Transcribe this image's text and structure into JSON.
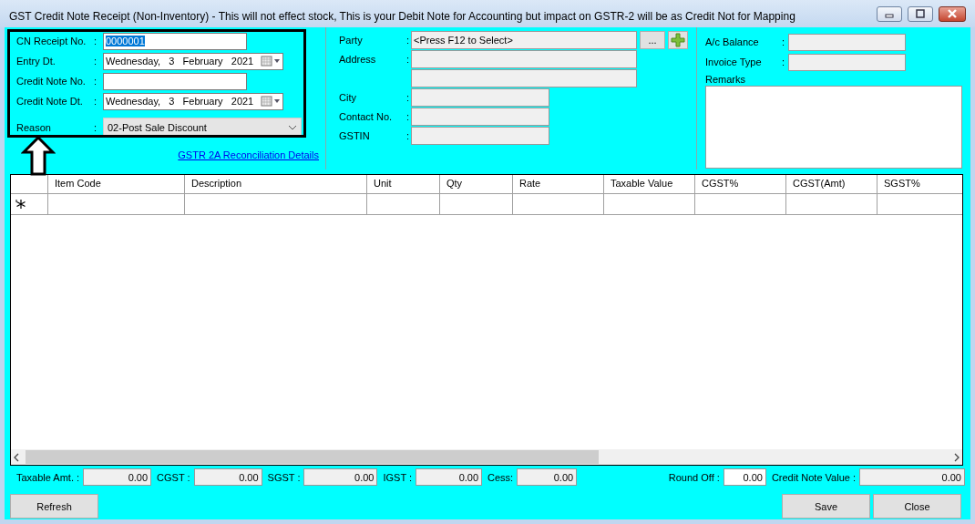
{
  "window": {
    "title": "GST Credit Note Receipt (Non-Inventory) - This will not effect stock, This is your Debit Note for Accounting but impact on GSTR-2 will be as Credit Not for Mapping"
  },
  "receipt": {
    "fields": [
      {
        "label": "CN Receipt No.",
        "colon": ":",
        "kind": "text",
        "value": "0000001",
        "value_selected": true
      },
      {
        "label": "Entry Dt.",
        "colon": ":",
        "kind": "date",
        "value": "Wednesday,   3   February   2021"
      },
      {
        "label": "Credit Note No.",
        "colon": ":",
        "kind": "text"
      },
      {
        "label": "Credit Note Dt.",
        "colon": ":",
        "kind": "date",
        "value": "Wednesday,   3   February   2021"
      },
      {
        "label": "Reason",
        "colon": ":",
        "kind": "combo",
        "value": "02-Post Sale Discount"
      }
    ],
    "link": "GSTR 2A Reconciliation Details"
  },
  "party": {
    "fields": [
      {
        "label": "Party",
        "colon": ":",
        "kind": "lookup",
        "value": "<Press F12 to Select>",
        "button": "..."
      },
      {
        "label": "Address",
        "colon": ":",
        "kind": "wide"
      },
      {
        "kind": "wide"
      },
      {
        "label": "City",
        "colon": ":",
        "kind": "short"
      },
      {
        "label": "Contact No.",
        "colon": ":",
        "kind": "short"
      },
      {
        "label": "GSTIN",
        "colon": ":",
        "kind": "short"
      }
    ]
  },
  "account": {
    "fields": [
      {
        "label": "A/c Balance",
        "colon": ":",
        "kind": "text"
      },
      {
        "label": "Invoice Type",
        "colon": ":",
        "kind": "text"
      },
      {
        "label": "Remarks",
        "kind": "memo"
      }
    ]
  },
  "grid": {
    "columns": [
      "Item Code",
      "Description",
      "Unit",
      "Qty",
      "Rate",
      "Taxable Value",
      "CGST%",
      "CGST(Amt)",
      "SGST%"
    ]
  },
  "totals": {
    "left": [
      {
        "label": "Taxable Amt. :",
        "value": "0.00",
        "editable": false
      },
      {
        "label": "CGST :",
        "value": "0.00",
        "editable": false
      },
      {
        "label": "SGST :",
        "value": "0.00",
        "editable": false
      },
      {
        "label": "IGST :",
        "value": "0.00",
        "editable": false
      },
      {
        "label": "Cess:",
        "value": "0.00",
        "editable": false
      }
    ],
    "right": [
      {
        "label": "Round Off :",
        "value": "0.00",
        "editable": true
      },
      {
        "label": "Credit Note Value :",
        "value": "0.00",
        "editable": false
      }
    ]
  },
  "buttons": {
    "left": [
      "Refresh"
    ],
    "right": [
      "Save",
      "Close"
    ]
  }
}
